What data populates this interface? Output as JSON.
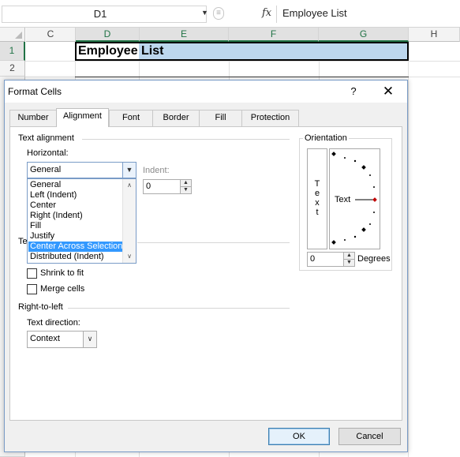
{
  "excel": {
    "name_box": "D1",
    "fx_label": "fx",
    "formula_value": "Employee List",
    "columns": [
      "C",
      "D",
      "E",
      "F",
      "G",
      "H"
    ],
    "rows": [
      "1",
      "2"
    ],
    "cell_d1_text": "Employee List"
  },
  "dialog": {
    "title": "Format Cells",
    "help": "?",
    "close": "✕",
    "tabs": [
      "Number",
      "Alignment",
      "Font",
      "Border",
      "Fill",
      "Protection"
    ],
    "active_tab": "Alignment",
    "text_alignment": {
      "section_label": "Text alignment",
      "horizontal_label": "Horizontal:",
      "horizontal_value": "General",
      "horizontal_options": [
        "General",
        "Left (Indent)",
        "Center",
        "Right (Indent)",
        "Fill",
        "Justify",
        "Center Across Selection",
        "Distributed (Indent)"
      ],
      "highlighted_option": "Center Across Selection",
      "indent_label": "Indent:",
      "indent_value": "0"
    },
    "text_control": {
      "section_label_partial": "Te",
      "shrink_to_fit": "Shrink to fit",
      "merge_cells": "Merge cells"
    },
    "right_to_left": {
      "section_label": "Right-to-left",
      "text_direction_label": "Text direction:",
      "text_direction_value": "Context"
    },
    "orientation": {
      "section_label": "Orientation",
      "vertical_letters": [
        "T",
        "e",
        "x",
        "t"
      ],
      "dial_text": "Text",
      "degrees_value": "0",
      "degrees_label": "Degrees"
    },
    "buttons": {
      "ok": "OK",
      "cancel": "Cancel"
    }
  }
}
